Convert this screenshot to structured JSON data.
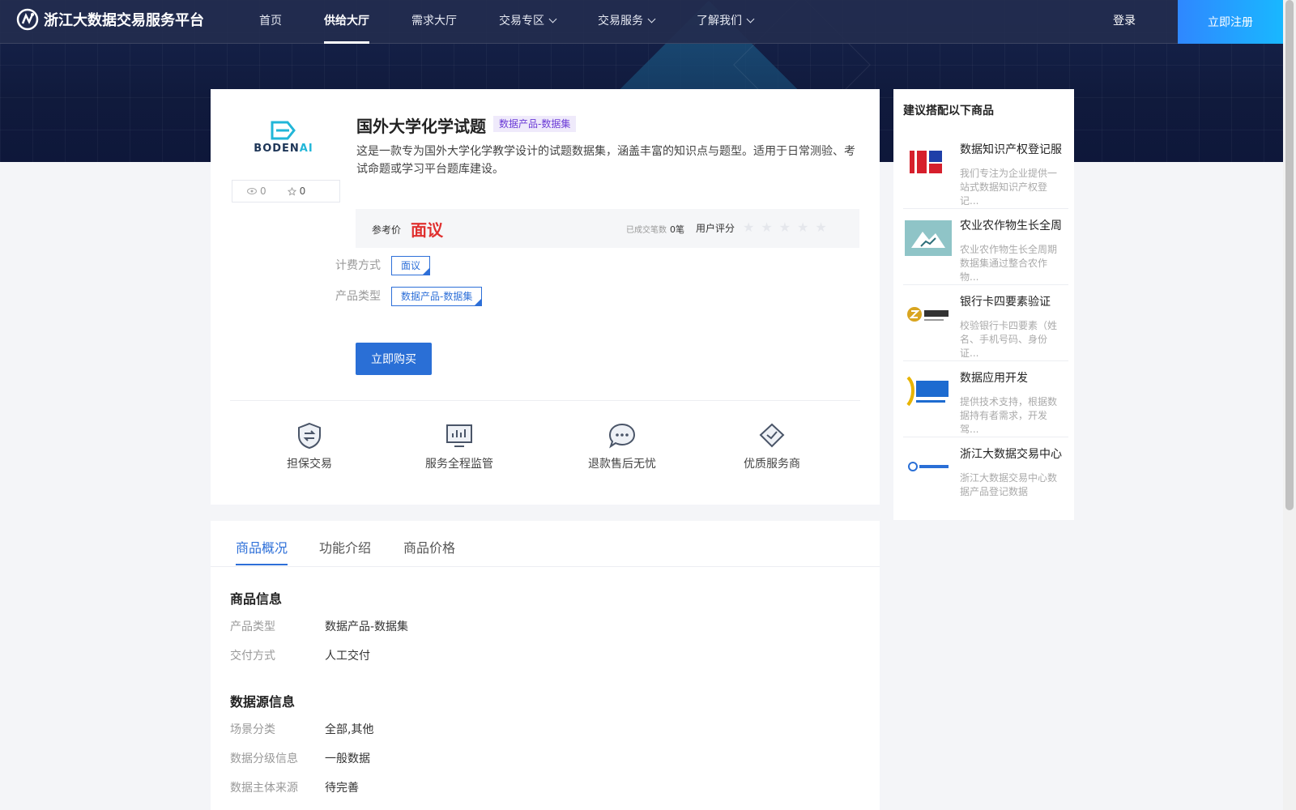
{
  "nav": {
    "logo_text": "浙江大数据交易服务平台",
    "items": [
      {
        "label": "首页",
        "active": false,
        "dropdown": false
      },
      {
        "label": "供给大厅",
        "active": true,
        "dropdown": false
      },
      {
        "label": "需求大厅",
        "active": false,
        "dropdown": false
      },
      {
        "label": "交易专区",
        "active": false,
        "dropdown": true
      },
      {
        "label": "交易服务",
        "active": false,
        "dropdown": true
      },
      {
        "label": "了解我们",
        "active": false,
        "dropdown": true
      }
    ],
    "login": "登录",
    "register": "立即注册"
  },
  "product": {
    "logo_name_a": "BODEN",
    "logo_name_b": "AI",
    "views": "0",
    "favorites": "0",
    "title": "国外大学化学试题",
    "badge": "数据产品-数据集",
    "description": "这是一款专为国外大学化学教学设计的试题数据集，涵盖丰富的知识点与题型。适用于日常测验、考试命题或学习平台题库建设。",
    "price_label": "参考价",
    "price": "面议",
    "deals_label": "已成交笔数",
    "deals_value": "0笔",
    "rating_label": "用户评分",
    "rating_stars": "★★★★★",
    "billing_label": "计费方式",
    "billing_value": "面议",
    "type_label": "产品类型",
    "type_value": "数据产品-数据集",
    "buy_button": "立即购买"
  },
  "features": [
    {
      "label": "担保交易",
      "icon": "shield-exchange-icon"
    },
    {
      "label": "服务全程监管",
      "icon": "monitor-chart-icon"
    },
    {
      "label": "退款售后无忧",
      "icon": "chat-bubble-icon"
    },
    {
      "label": "优质服务商",
      "icon": "diamond-check-icon"
    }
  ],
  "sidebar": {
    "heading": "建议搭配以下商品",
    "items": [
      {
        "title": "数据知识产权登记服",
        "desc": "我们专注为企业提供一站式数据知识产权登记..."
      },
      {
        "title": "农业农作物生长全周",
        "desc": "农业农作物生长全周期数据集通过整合农作物..."
      },
      {
        "title": "银行卡四要素验证",
        "desc": "校验银行卡四要素（姓名、手机号码、身份证..."
      },
      {
        "title": "数据应用开发",
        "desc": "提供技术支持，根据数据持有者需求，开发驾..."
      },
      {
        "title": "浙江大数据交易中心",
        "desc": "浙江大数据交易中心数据产品登记数据"
      }
    ]
  },
  "tabs": {
    "items": [
      "商品概况",
      "功能介绍",
      "商品价格"
    ],
    "active": "商品概况"
  },
  "info": {
    "section1": "商品信息",
    "rows1": [
      {
        "k": "产品类型",
        "v": "数据产品-数据集"
      },
      {
        "k": "交付方式",
        "v": "人工交付"
      }
    ],
    "section2": "数据源信息",
    "rows2": [
      {
        "k": "场景分类",
        "v": "全部,其他"
      },
      {
        "k": "数据分级信息",
        "v": "一般数据"
      },
      {
        "k": "数据主体来源",
        "v": "待完善"
      }
    ]
  },
  "colors": {
    "primary": "#2a6fd6",
    "price": "#e0302f",
    "nav_bg": "#232d4e"
  }
}
